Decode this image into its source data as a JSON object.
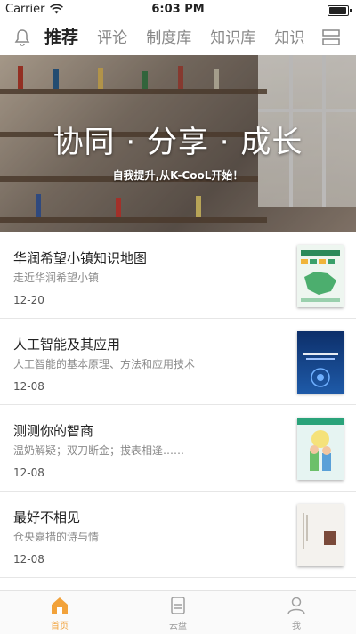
{
  "status_bar": {
    "carrier": "Carrier",
    "time": "6:03 PM",
    "battery_level": 0.95
  },
  "nav": {
    "tabs": [
      {
        "label": "推荐",
        "active": true
      },
      {
        "label": "评论",
        "active": false
      },
      {
        "label": "制度库",
        "active": false
      },
      {
        "label": "知识库",
        "active": false
      },
      {
        "label": "知识",
        "active": false
      }
    ],
    "icons": {
      "left": "bell-icon",
      "right": "menu-icon"
    }
  },
  "banner": {
    "title": "协同 · 分享 · 成长",
    "subtitle": "自我提升,从K-CooL开始！"
  },
  "articles": [
    {
      "title": "华润希望小镇知识地图",
      "desc": "走近华润希望小镇",
      "date": "12-20",
      "thumb_color": "#e9f3ec"
    },
    {
      "title": "人工智能及其应用",
      "desc": "人工智能的基本原理、方法和应用技术",
      "date": "12-08",
      "thumb_color": "#123a7a"
    },
    {
      "title": "测测你的智商",
      "desc": "温奶解疑；双刀断金；拔表相逢……",
      "date": "12-08",
      "thumb_color": "#e8f5f4"
    },
    {
      "title": "最好不相见",
      "desc": "仓央嘉措的诗与情",
      "date": "12-08",
      "thumb_color": "#f2f0ec"
    }
  ],
  "tabbar": {
    "accent_color": "#f2a23a",
    "items": [
      {
        "label": "首页",
        "icon": "home-icon",
        "active": true
      },
      {
        "label": "云盘",
        "icon": "cloud-disk-icon",
        "active": false
      },
      {
        "label": "我",
        "icon": "user-icon",
        "active": false
      }
    ]
  }
}
